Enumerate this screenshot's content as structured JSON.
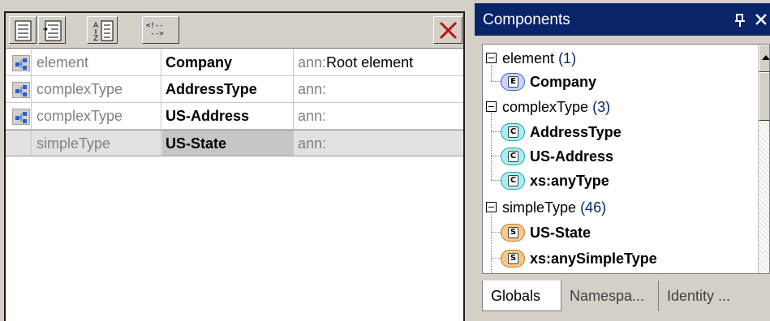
{
  "toolbar": {
    "comment_button_text": "<!--\n -->",
    "icons": [
      "append-icon",
      "insert-icon",
      "sort-icon",
      "comment-icon",
      "delete-icon"
    ]
  },
  "schema_rows": [
    {
      "kind": "element",
      "name": "Company",
      "ann_prefix": "ann:",
      "ann_value": "Root element",
      "selected": false
    },
    {
      "kind": "complexType",
      "name": "AddressType",
      "ann_prefix": "ann:",
      "ann_value": "",
      "selected": false
    },
    {
      "kind": "complexType",
      "name": "US-Address",
      "ann_prefix": "ann:",
      "ann_value": "",
      "selected": false
    },
    {
      "kind": "simpleType",
      "name": "US-State",
      "ann_prefix": "ann:",
      "ann_value": "",
      "selected": true
    }
  ],
  "components": {
    "title": "Components",
    "tree": [
      {
        "category": "element",
        "count": "(1)",
        "items": [
          {
            "badge": "E",
            "label": "Company"
          }
        ]
      },
      {
        "category": "complexType",
        "count": "(3)",
        "items": [
          {
            "badge": "C",
            "label": "AddressType"
          },
          {
            "badge": "C",
            "label": "US-Address"
          },
          {
            "badge": "C",
            "label": "xs:anyType"
          }
        ]
      },
      {
        "category": "simpleType",
        "count": "(46)",
        "items": [
          {
            "badge": "S",
            "label": "US-State"
          },
          {
            "badge": "S",
            "label": "xs:anySimpleType"
          }
        ]
      }
    ],
    "tabs": [
      "Globals",
      "Namespa...",
      "Identity ..."
    ]
  },
  "colors": {
    "title_bar": "#0a246a",
    "element_badge": "#c8d4ff",
    "complex_badge": "#a8f0f0",
    "simple_badge": "#f6c88a",
    "delete_x": "#c01010"
  }
}
